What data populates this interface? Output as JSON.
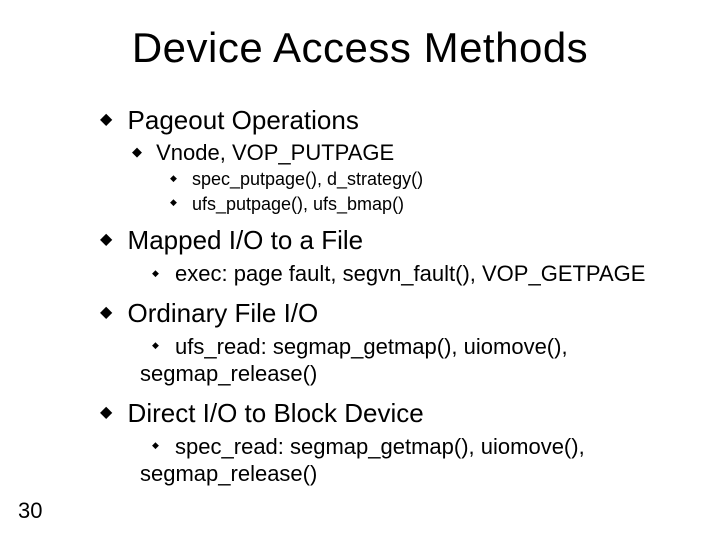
{
  "title": "Device Access Methods",
  "sections": [
    {
      "heading": "Pageout Operations",
      "sub": [
        {
          "text": "Vnode, VOP_PUTPAGE",
          "items": [
            "spec_putpage(), d_strategy()",
            "ufs_putpage(), ufs_bmap()"
          ]
        }
      ]
    },
    {
      "heading": "Mapped I/O to a File",
      "detail": "exec: page fault, segvn_fault(), VOP_GETPAGE"
    },
    {
      "heading": "Ordinary File I/O",
      "detail": "ufs_read: segmap_getmap(), uiomove(),",
      "detail_cont": "segmap_release()"
    },
    {
      "heading": "Direct I/O to Block Device",
      "detail": "spec_read: segmap_getmap(), uiomove(),",
      "detail_cont": "segmap_release()"
    }
  ],
  "page_number": "30"
}
